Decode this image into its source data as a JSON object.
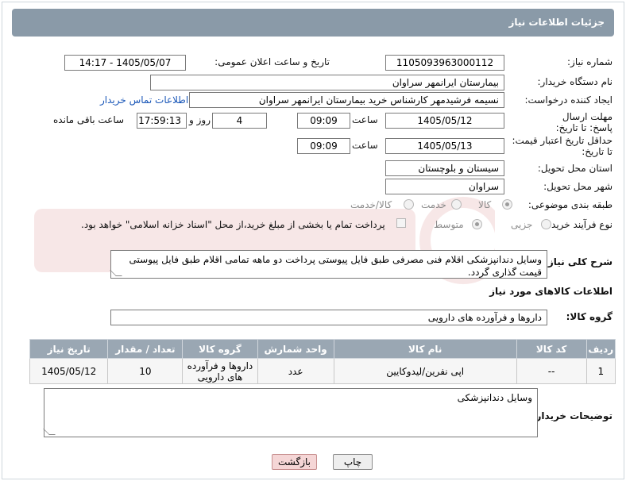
{
  "header": {
    "title": "جزئیات اطلاعات نیاز"
  },
  "fields": {
    "need_number_label": "شماره نیاز:",
    "need_number": "1105093963000112",
    "announce_label": "تاریخ و ساعت اعلان عمومی:",
    "announce_value": "1405/05/07 - 14:17",
    "buyer_org_label": "نام دستگاه خریدار:",
    "buyer_org": "بیمارستان ایرانمهر سراوان",
    "requester_label": "ایجاد کننده درخواست:",
    "requester": "نسیمه فرشیدمهر کارشناس خرید بیمارستان ایرانمهر سراوان",
    "contact_link": "اطلاعات تماس خریدار",
    "reply_deadline_label": "مهلت ارسال پاسخ: تا تاریخ:",
    "reply_date": "1405/05/12",
    "time_label": "ساعت",
    "reply_time": "09:09",
    "days_value": "4",
    "days_label": "روز و",
    "remaining_time": "17:59:13",
    "remaining_label": "ساعت باقی مانده",
    "price_validity_label": "حداقل تاریخ اعتبار قیمت: تا تاریخ:",
    "price_date": "1405/05/13",
    "price_time": "09:09",
    "province_label": "استان محل تحویل:",
    "province": "سیستان و بلوچستان",
    "city_label": "شهر محل تحویل:",
    "city": "سراوان",
    "category_label": "طبقه بندی موضوعی:",
    "category_options": [
      "کالا",
      "خدمت",
      "کالا/خدمت"
    ],
    "process_label": "نوع فرآیند خرید :",
    "process_options": [
      "جزیی",
      "متوسط"
    ],
    "payment_note": "پرداخت تمام یا بخشی از مبلغ خرید،از محل \"اسناد خزانه اسلامی\" خواهد بود.",
    "description_label": "شرح کلی نیاز:",
    "description": "وسایل  دندانپزشکی اقلام فنی مصرفی طبق فایل پیوستی پرداخت دو ماهه تمامی اقلام طبق فایل پیوستی قیمت گذاری گردد.",
    "goods_info_label": "اطلاعات کالاهای مورد نیاز",
    "goods_group_label": "گروه کالا:",
    "goods_group": "داروها و فرآورده های دارویی",
    "buyer_notes_label": "توضیحات خریدار:",
    "buyer_notes": "وسایل دندانپزشکی"
  },
  "table": {
    "headers": [
      "ردیف",
      "کد کالا",
      "نام کالا",
      "واحد شمارش",
      "گروه کالا",
      "تعداد / مقدار",
      "تاریخ نیاز"
    ],
    "rows": [
      [
        "1",
        "--",
        "اپی نفرین/لیدوکایین",
        "عدد",
        "داروها و فرآورده های دارویی",
        "10",
        "1405/05/12"
      ]
    ]
  },
  "buttons": {
    "print": "چاپ",
    "back": "بازگشت"
  },
  "colors": {
    "header_bg": "#8a9aa8",
    "table_header_bg": "#9aa7b3",
    "link": "#1a57b8",
    "back_button_bg": "#f5d6d6"
  }
}
